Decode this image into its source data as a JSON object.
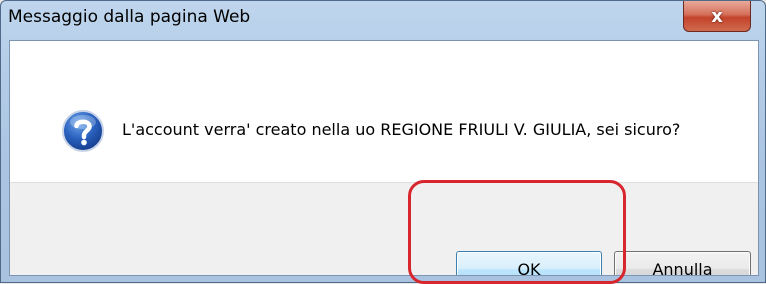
{
  "window": {
    "title": "Messaggio dalla pagina Web",
    "close_glyph": "x",
    "close_icon": "close-icon"
  },
  "dialog": {
    "icon": "question-icon",
    "message": "L'account verra' creato nella uo REGIONE FRIULI V. GIULIA, sei sicuro?"
  },
  "buttons": {
    "ok_label": "OK",
    "cancel_label": "Annulla"
  },
  "annotation": {
    "color": "#d8262e",
    "target": "ok-button"
  }
}
